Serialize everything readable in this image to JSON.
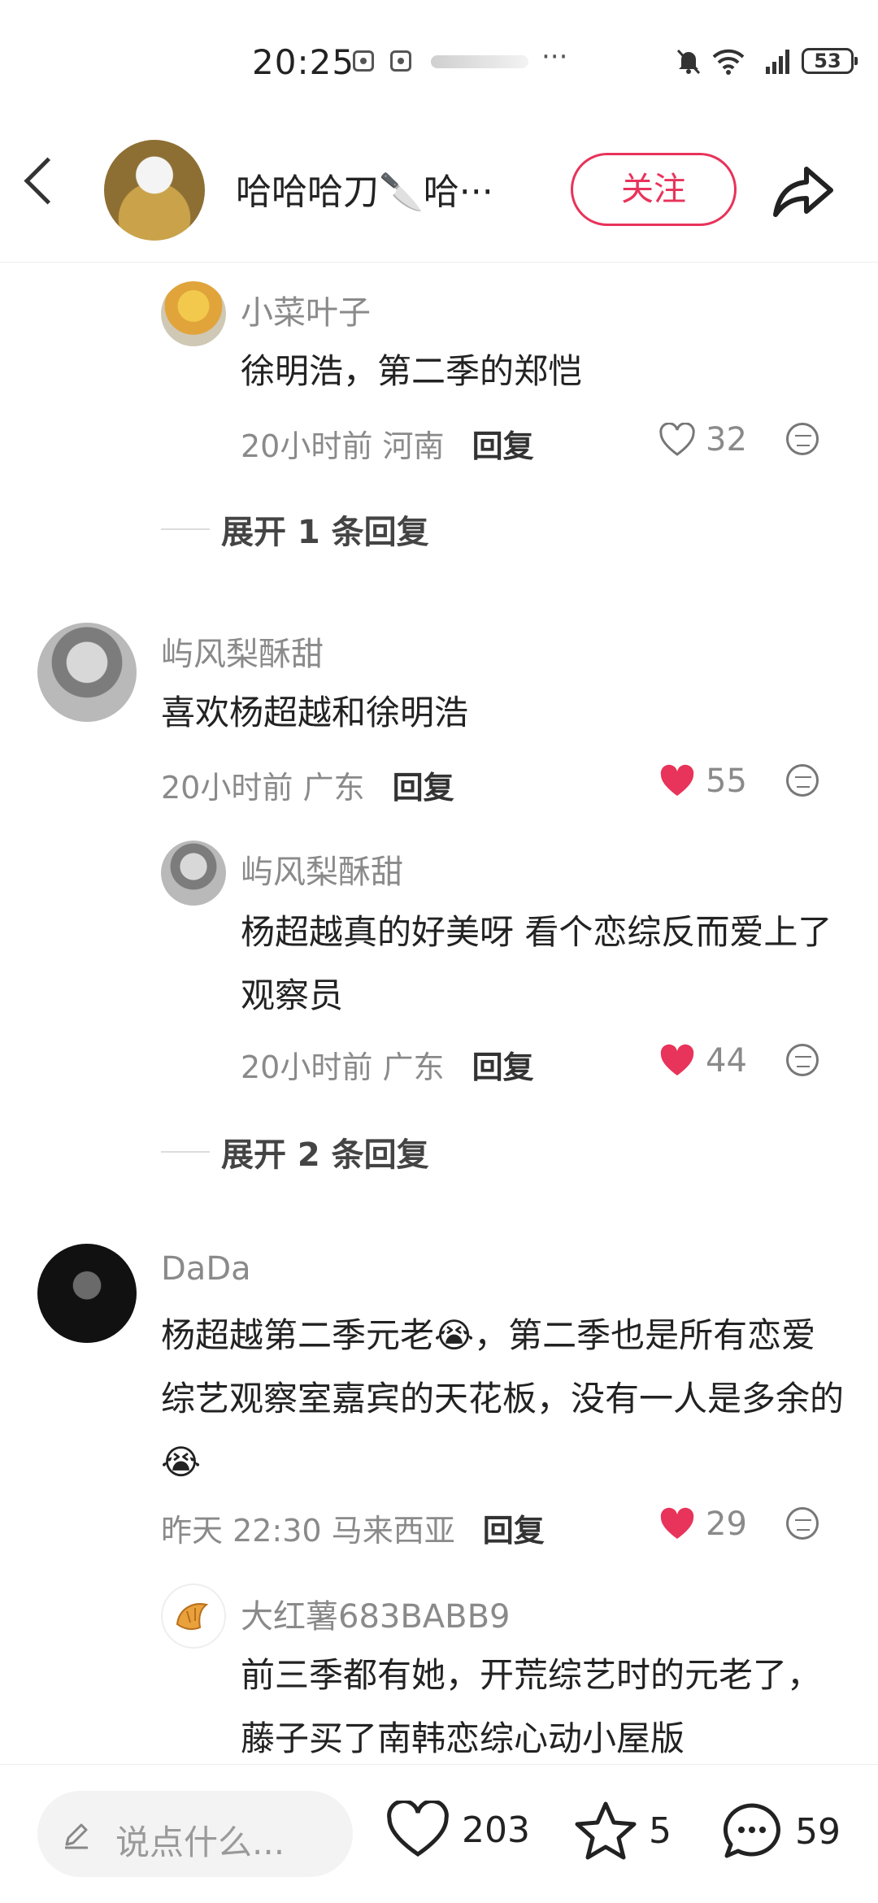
{
  "status_bar": {
    "time": "20:25",
    "battery": "53"
  },
  "header": {
    "title": "哈哈哈刀🔪哈···",
    "follow_label": "关注"
  },
  "comments": [
    {
      "name": "小菜叶子",
      "text": "徐明浩，第二季的郑恺",
      "time": "20小时前",
      "region": "河南",
      "reply_label": "回复",
      "likes": "32",
      "liked": false
    },
    {
      "name": "屿风梨酥甜",
      "text": "喜欢杨超越和徐明浩",
      "time": "20小时前",
      "region": "广东",
      "reply_label": "回复",
      "likes": "55",
      "liked": true
    },
    {
      "name": "屿风梨酥甜",
      "text": "杨超越真的好美呀 看个恋综反而爱上了观察员",
      "time": "20小时前",
      "region": "广东",
      "reply_label": "回复",
      "likes": "44",
      "liked": true
    },
    {
      "name": "DaDa",
      "text": "杨超越第二季元老😭，第二季也是所有恋爱综艺观察室嘉宾的天花板，没有一人是多余的😭",
      "time": "昨天 22:30",
      "region": "马来西亚",
      "reply_label": "回复",
      "likes": "29",
      "liked": true
    },
    {
      "name": "大红薯683BABB9",
      "text": "前三季都有她，开荒综艺时的元老了，藤子买了南韩恋综心动小屋版"
    }
  ],
  "expand_replies": [
    "展开 1 条回复",
    "展开 2 条回复"
  ],
  "bottom_bar": {
    "input_placeholder": "说点什么...",
    "likes": "203",
    "favorites": "5",
    "comments": "59"
  },
  "colors": {
    "accent": "#e8335a",
    "muted": "#8a8a8a"
  }
}
